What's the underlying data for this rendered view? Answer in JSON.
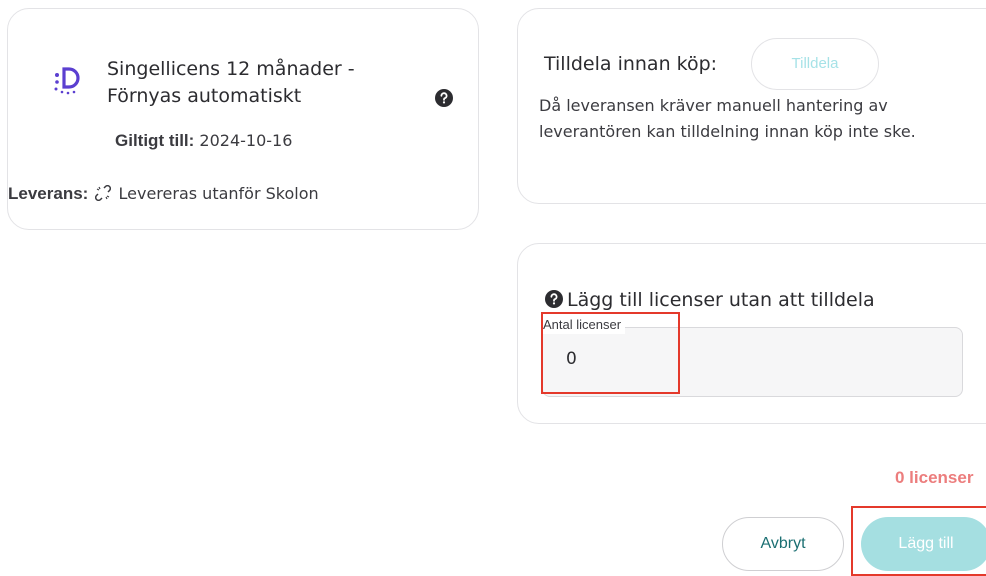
{
  "product": {
    "title": "Singellicens 12 månader - Förnyas automatiskt",
    "valid_label": "Giltigt till:",
    "valid_date": "2024-10-16",
    "delivery_label": "Leverans:",
    "delivery_value": "Levereras utanför Skolon",
    "logo_icon": "dotted-d-logo",
    "help_icon": "question-circle-icon",
    "delivery_icon": "broken-link-icon"
  },
  "assign": {
    "heading": "Tilldela innan köp:",
    "button_label": "Tilldela",
    "description": "Då leveransen kräver manuell hantering av leverantören kan tilldelning innan köp inte ske."
  },
  "add_licenses": {
    "heading": "Lägg till licenser utan att tilldela",
    "field_label": "Antal licenser",
    "field_value": "0"
  },
  "footer": {
    "count_label": "0 licenser",
    "cancel_label": "Avbryt",
    "add_label": "Lägg till"
  },
  "colors": {
    "accent_teal": "#a5dfe1",
    "cancel_text": "#1b6f72",
    "count_text": "#ec7d7d",
    "highlight": "#e4392b",
    "logo": "#5b3fd0"
  }
}
